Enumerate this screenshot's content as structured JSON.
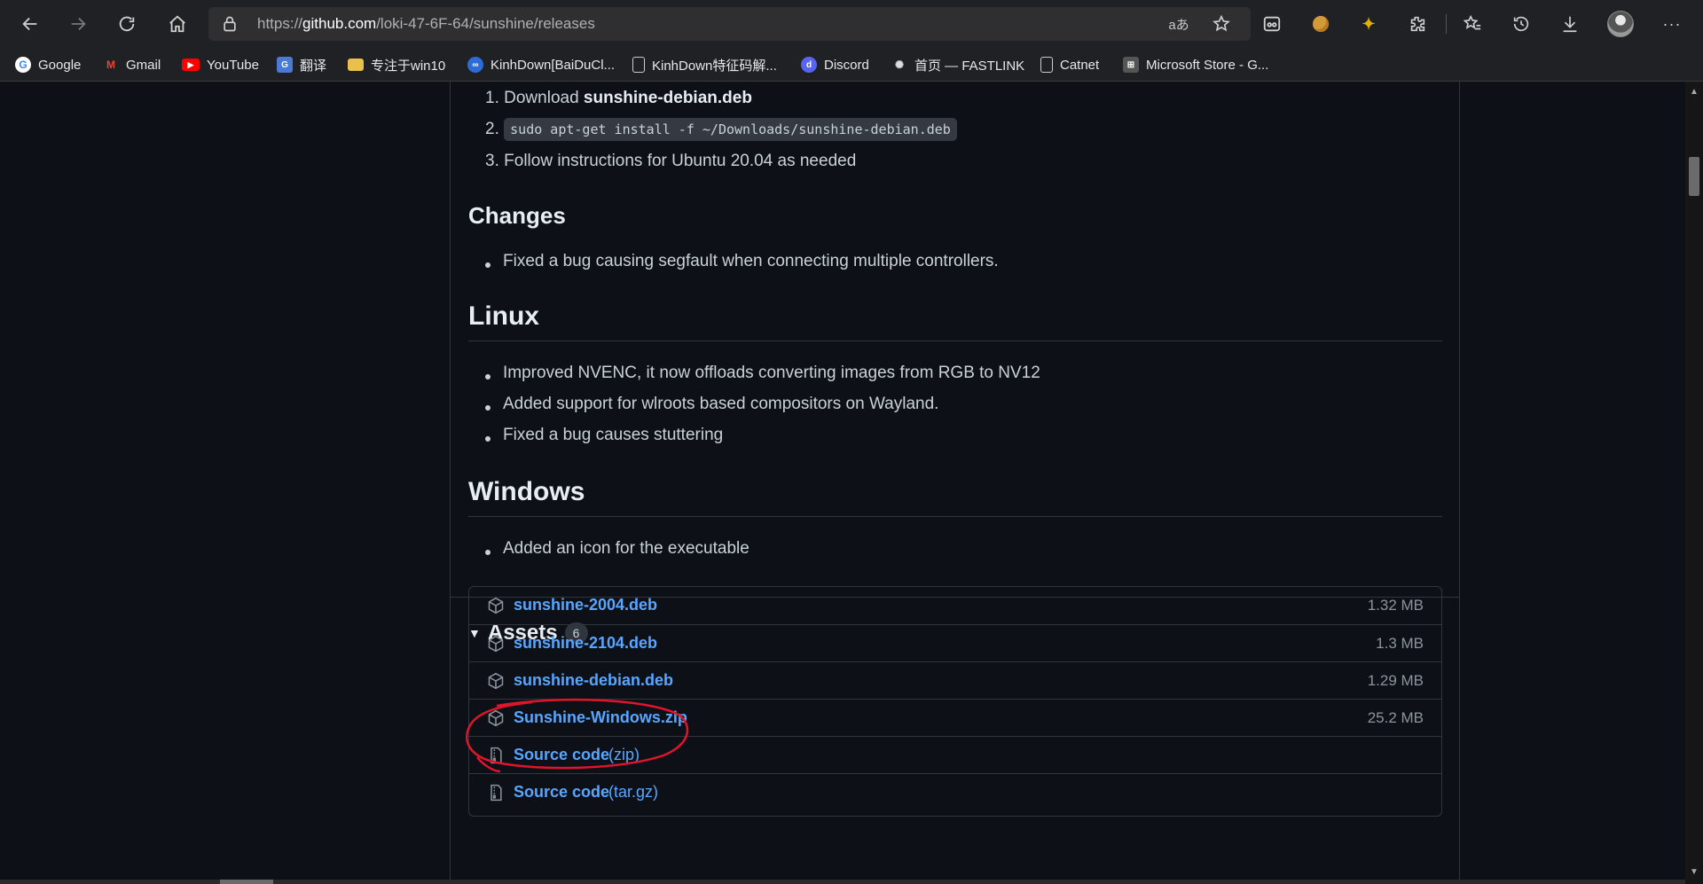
{
  "browser": {
    "url_prefix": "https://",
    "url_host": "github.com",
    "url_path": "/loki-47-6F-64/sunshine/releases"
  },
  "bookmarks": [
    {
      "label": "Google",
      "icon": "google-icon"
    },
    {
      "label": "Gmail",
      "icon": "gmail-icon"
    },
    {
      "label": "YouTube",
      "icon": "youtube-icon"
    },
    {
      "label": "翻译",
      "icon": "translate-icon"
    },
    {
      "label": "专注于win10",
      "icon": "folder-icon"
    },
    {
      "label": "KinhDown[BaiDuCl...",
      "icon": "kinhdown-icon"
    },
    {
      "label": "KinhDown特征码解...",
      "icon": "page-icon"
    },
    {
      "label": "Discord",
      "icon": "discord-icon"
    },
    {
      "label": "首页 — FASTLINK",
      "icon": "fastlink-icon"
    },
    {
      "label": "Catnet",
      "icon": "page-icon"
    },
    {
      "label": "Microsoft Store - G...",
      "icon": "store-icon"
    }
  ],
  "release": {
    "steps": {
      "s1_num": "1.",
      "s1_text": "Download ",
      "s1_bold": "sunshine-debian.deb",
      "s2_num": "2.",
      "s2_code": "sudo apt-get install -f ~/Downloads/sunshine-debian.deb",
      "s3_num": "3.",
      "s3_text": "Follow instructions for Ubuntu 20.04 as needed"
    },
    "changes": {
      "heading": "Changes",
      "items": [
        "Fixed a bug causing segfault when connecting multiple controllers."
      ]
    },
    "linux": {
      "heading": "Linux",
      "items": [
        "Improved NVENC, it now offloads converting images from RGB to NV12",
        "Added support for wlroots based compositors on Wayland.",
        "Fixed a bug causes stuttering"
      ]
    },
    "windows": {
      "heading": "Windows",
      "items": [
        "Added an icon for the executable"
      ]
    }
  },
  "assets": {
    "title": "Assets",
    "count": "6",
    "rows": [
      {
        "name": "sunshine-2004.deb",
        "size": "1.32 MB",
        "icon": "package-icon"
      },
      {
        "name": "sunshine-2104.deb",
        "size": "1.3 MB",
        "icon": "package-icon"
      },
      {
        "name": "sunshine-debian.deb",
        "size": "1.29 MB",
        "icon": "package-icon"
      },
      {
        "name": "Sunshine-Windows.zip",
        "size": "25.2 MB",
        "icon": "package-icon"
      },
      {
        "name": "Source code",
        "ext": "(zip)",
        "size": "",
        "icon": "file-zip-icon"
      },
      {
        "name": "Source code",
        "ext": "(tar.gz)",
        "size": "",
        "icon": "file-zip-icon"
      }
    ]
  },
  "colors": {
    "page_bg": "#0d1117",
    "link": "#58a6ff",
    "annotation": "#e0142a"
  }
}
